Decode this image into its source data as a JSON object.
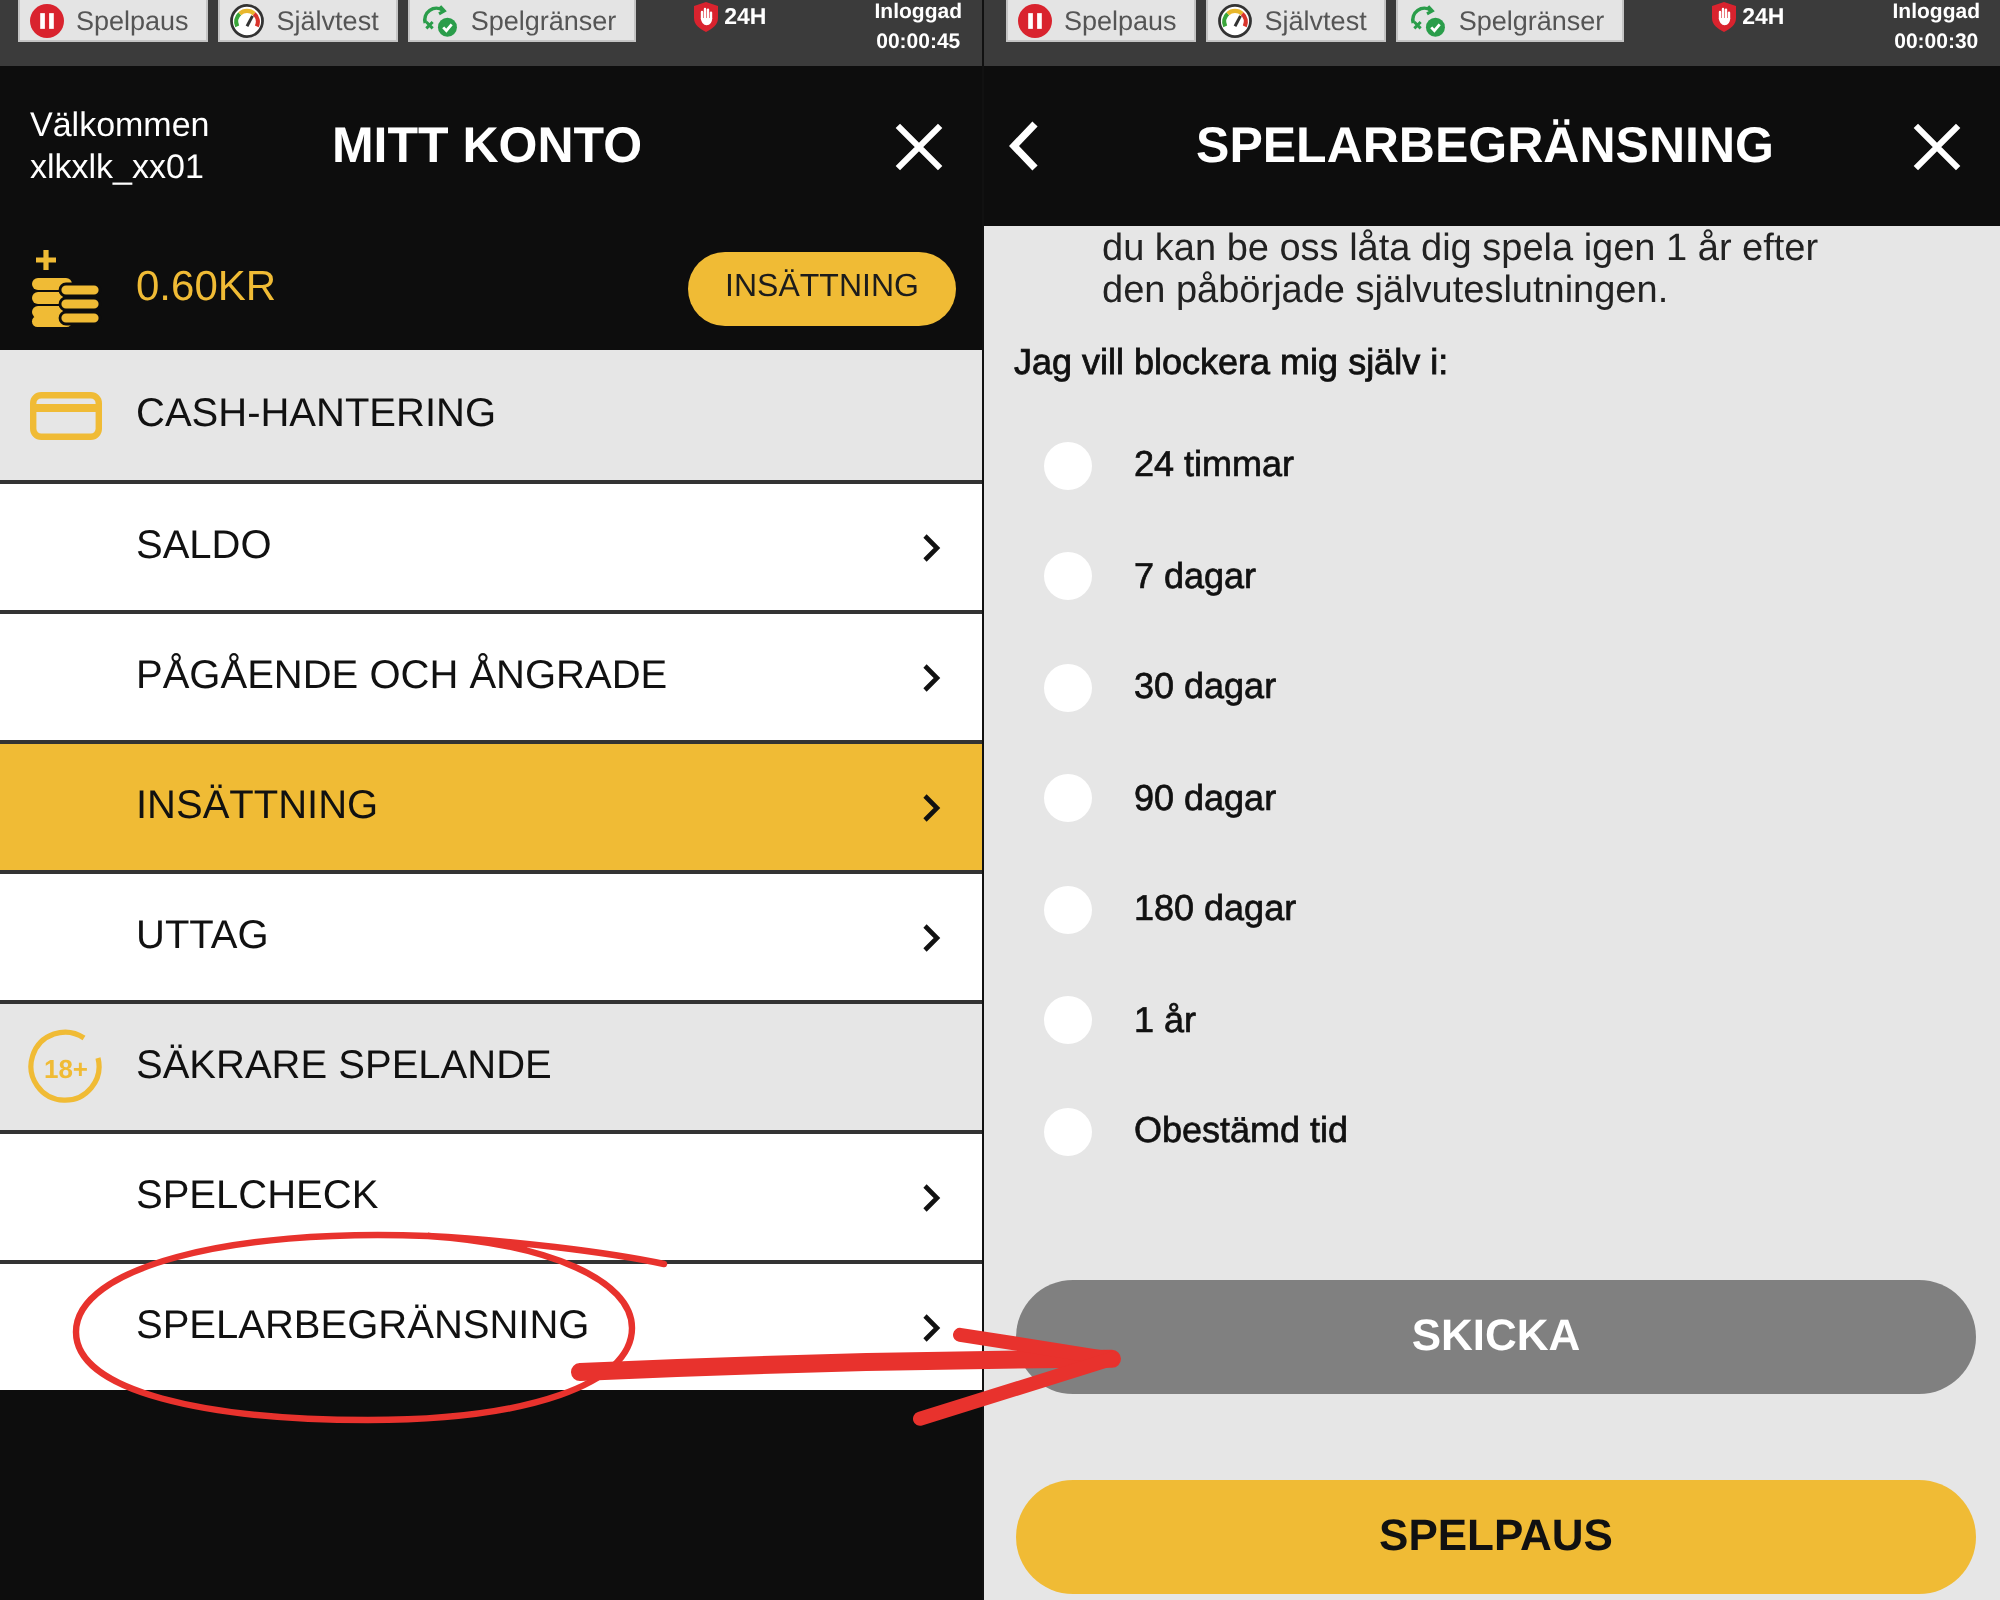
{
  "account_screen": {
    "status_bar": {
      "tabs": [
        {
          "kind": "pause",
          "label": "Spelpaus"
        },
        {
          "kind": "selftest",
          "label": "Självtest"
        },
        {
          "kind": "limits",
          "label": "Spelgränser"
        }
      ],
      "limit": "24H",
      "session_label": "Inloggad",
      "session_time": "00:00:45"
    },
    "header": {
      "greeting": "Välkommen",
      "username": "xlkxlk_xx01",
      "title": "MITT KONTO"
    },
    "balance": {
      "amount": "0.60KR",
      "button": "INSÄTTNING"
    },
    "menu": [
      {
        "kind": "cash",
        "label": "CASH-HANTERING",
        "items": [
          {
            "label": "SALDO",
            "selected": false,
            "circled": false
          },
          {
            "label": "PÅGÅENDE OCH ÅNGRADE",
            "selected": false,
            "circled": false
          },
          {
            "label": "INSÄTTNING",
            "selected": true,
            "circled": false
          },
          {
            "label": "UTTAG",
            "selected": false,
            "circled": false
          }
        ]
      },
      {
        "kind": "safety",
        "label": "SÄKRARE SPELANDE",
        "icon_text": "18+",
        "items": [
          {
            "label": "SPELCHECK",
            "selected": false,
            "circled": false
          },
          {
            "label": "SPELARBEGRÄNSNING",
            "selected": false,
            "circled": true
          }
        ]
      }
    ]
  },
  "limit_screen": {
    "status_bar": {
      "tabs": [
        {
          "kind": "pause",
          "label": "Spelpaus"
        },
        {
          "kind": "selftest",
          "label": "Självtest"
        },
        {
          "kind": "limits",
          "label": "Spelgränser"
        }
      ],
      "limit": "24H",
      "session_label": "Inloggad",
      "session_time": "00:00:30"
    },
    "header": {
      "title": "SPELARBEGRÄNSNING"
    },
    "intro": "du kan be oss låta dig spela igen 1 år efter den påbörjade självuteslutningen.",
    "question": "Jag vill blockera mig själv i:",
    "options": [
      {
        "label": "24 timmar",
        "selected": false
      },
      {
        "label": "7 dagar",
        "selected": false
      },
      {
        "label": "30 dagar",
        "selected": false
      },
      {
        "label": "90 dagar",
        "selected": false
      },
      {
        "label": "180 dagar",
        "selected": false
      },
      {
        "label": "1 år",
        "selected": false
      },
      {
        "label": "Obestämd tid",
        "selected": false
      }
    ],
    "buttons": [
      {
        "label": "SKICKA",
        "disabled": true
      },
      {
        "label": "SPELPAUS",
        "disabled": false
      }
    ]
  }
}
